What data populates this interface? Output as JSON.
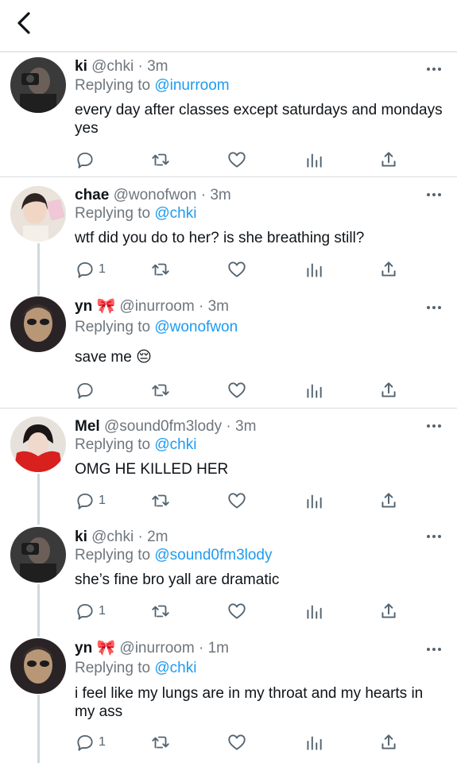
{
  "tweets": [
    {
      "name": "ki",
      "emoji": "",
      "handle": "@chki",
      "dot": "·",
      "time": "3m",
      "reply_prefix": "Replying to",
      "reply_to": "@inurroom",
      "text": "every day after classes except saturdays and mondays yes",
      "reply_count": ""
    },
    {
      "name": "chae",
      "emoji": "",
      "handle": "@wonofwon",
      "dot": "·",
      "time": "3m",
      "reply_prefix": "Replying to",
      "reply_to": "@chki",
      "text": "wtf did you do to her? is she breathing still?",
      "reply_count": "1"
    },
    {
      "name": "yn",
      "emoji": "🎀",
      "handle": "@inurroom",
      "dot": "·",
      "time": "3m",
      "reply_prefix": "Replying to",
      "reply_to": "@wonofwon",
      "text": "save me 😔",
      "reply_count": ""
    },
    {
      "name": "Mel",
      "emoji": "",
      "handle": "@sound0fm3lody",
      "dot": "·",
      "time": "3m",
      "reply_prefix": "Replying to",
      "reply_to": "@chki",
      "text": "OMG HE KILLED HER",
      "reply_count": "1"
    },
    {
      "name": "ki",
      "emoji": "",
      "handle": "@chki",
      "dot": "·",
      "time": "2m",
      "reply_prefix": "Replying to",
      "reply_to": "@sound0fm3lody",
      "text": "she’s fine bro yall are dramatic",
      "reply_count": "1"
    },
    {
      "name": "yn",
      "emoji": "🎀",
      "handle": "@inurroom",
      "dot": "·",
      "time": "1m",
      "reply_prefix": "Replying to",
      "reply_to": "@chki",
      "text": "i feel like my lungs are in my throat and my hearts in my ass",
      "reply_count": "1"
    }
  ],
  "icons": {
    "back": "chevron-left-icon",
    "more": "more-dots-icon",
    "reply": "reply-bubble-icon",
    "retweet": "retweet-icon",
    "like": "heart-icon",
    "stats": "bar-chart-icon",
    "share": "share-upload-icon"
  },
  "colors": {
    "mention": "#1d9bf0",
    "secondary_text": "#6e767d",
    "primary_text": "#0f1419",
    "icon": "#536471",
    "thread_line": "#cfd9de"
  }
}
